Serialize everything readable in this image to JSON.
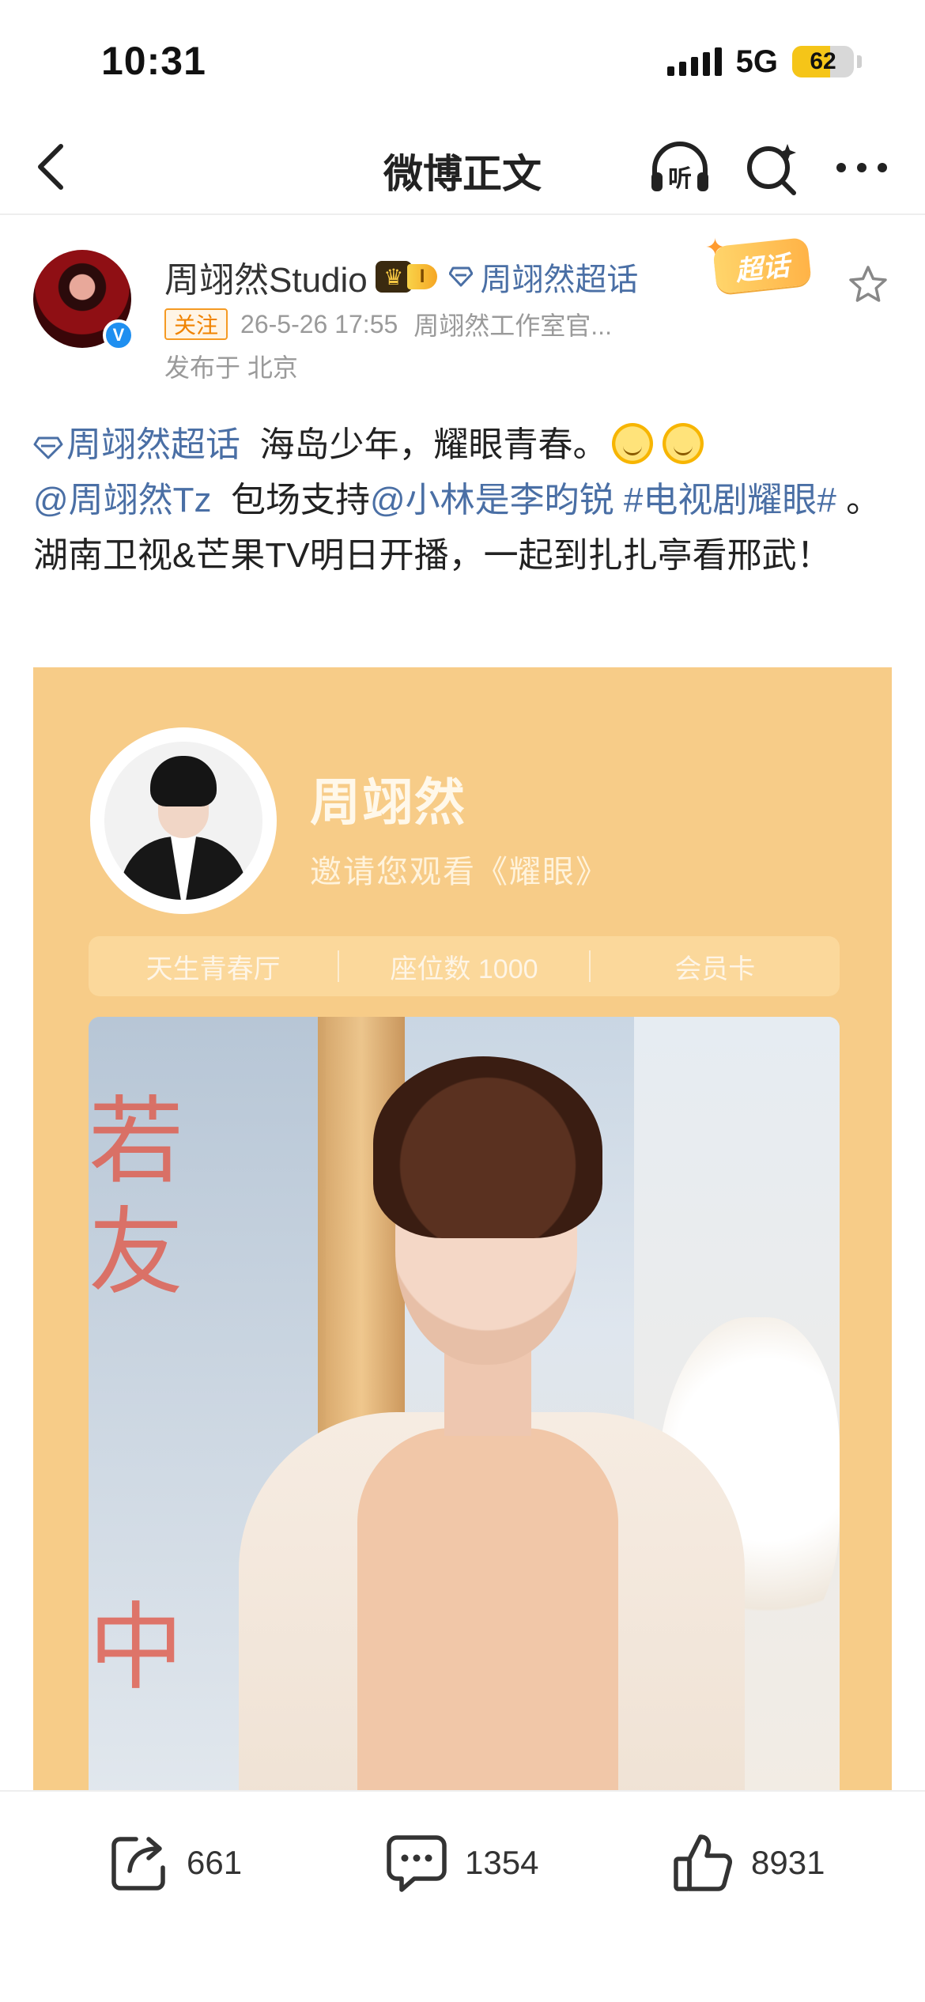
{
  "status_bar": {
    "time": "10:31",
    "network": "5G",
    "battery": "62",
    "battery_level": 0.62
  },
  "nav": {
    "title": "微博正文",
    "back_icon": "chevron-left-icon",
    "listen_icon": "headphones-icon",
    "listen_label": "听",
    "search_icon": "search-sparkle-icon",
    "more_icon": "more-icon"
  },
  "post": {
    "author": "周翊然Studio",
    "level_badge": "I",
    "supertopic": "周翊然超话",
    "super_badge": "超话",
    "follow_label": "关注",
    "timestamp": "26-5-26 17:55",
    "source": "周翊然工作室官...",
    "location": "发布于 北京",
    "text": {
      "topic_link": "周翊然超话",
      "line1": "海岛少年，耀眼青春。",
      "mention1": "@周翊然Tz",
      "support": "包场支持",
      "mention2": "@小林是李昀锐",
      "hashtag": "#电视剧耀眼#",
      "rest": "。湖南卫视&芒果TV明日开播，一起到扎扎亭看邢武！"
    },
    "card": {
      "name": "周翊然",
      "invite": "邀请您观看《耀眼》",
      "ticket": {
        "hall": "天生青春厅",
        "seat": "座位数 1000",
        "member": "会员卡"
      }
    }
  },
  "toolbar": {
    "share_count": "661",
    "comment_count": "1354",
    "like_count": "8931"
  },
  "colors": {
    "link": "#4a6fa5",
    "follow": "#f08300",
    "card_bg": "#f7cc88",
    "verified": "#1f8ff0"
  }
}
